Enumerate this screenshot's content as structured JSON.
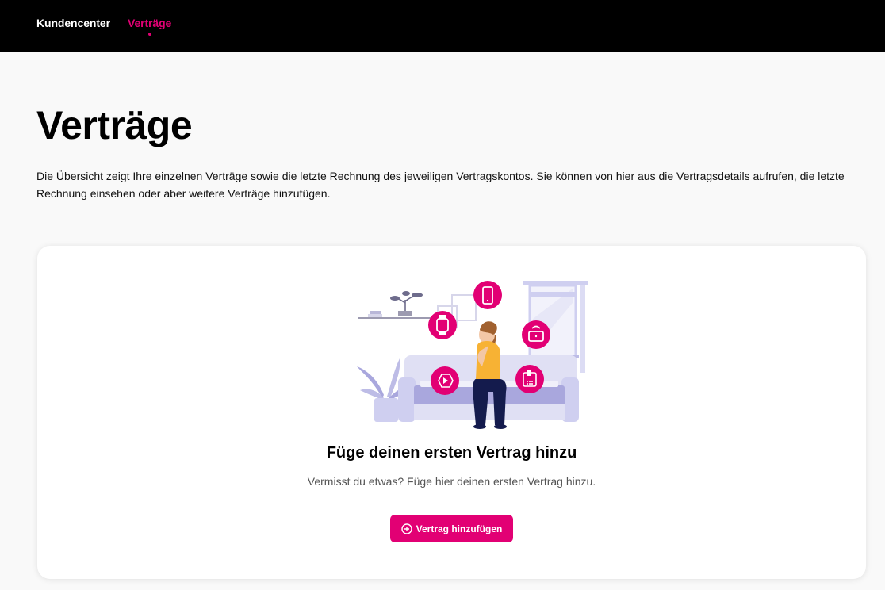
{
  "nav": {
    "items": [
      {
        "label": "Kundencenter",
        "active": false
      },
      {
        "label": "Verträge",
        "active": true
      }
    ]
  },
  "colors": {
    "brand": "#e20074",
    "nav_bg": "#000000",
    "page_bg": "#f9f9f9",
    "illustration_accent": "#a9a7dd"
  },
  "page": {
    "title": "Verträge",
    "intro": "Die Übersicht zeigt Ihre einzelnen Verträge sowie die letzte Rechnung des jeweiligen Vertragskontos. Sie können von hier aus die Vertragsdetails aufrufen, die letzte Rechnung einsehen oder aber weitere Verträge hinzufügen."
  },
  "empty_state": {
    "illustration_icons": [
      "smartwatch-icon",
      "smartphone-icon",
      "router-icon",
      "play-icon",
      "landline-phone-icon"
    ],
    "title": "Füge deinen ersten Vertrag hinzu",
    "subtitle": "Vermisst du etwas? Füge hier deinen ersten Vertrag hinzu.",
    "button_icon": "plus-circle-icon",
    "button_label": "Vertrag hinzufügen"
  }
}
